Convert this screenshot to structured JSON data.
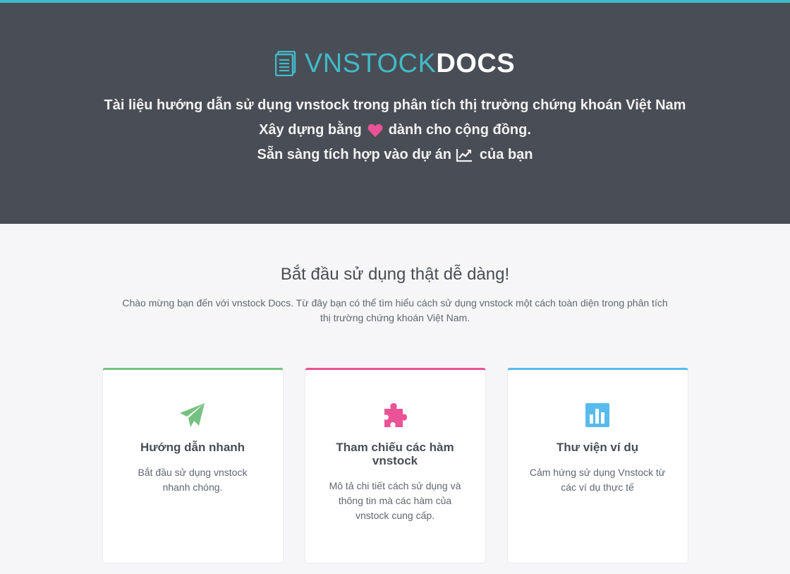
{
  "colors": {
    "accent": "#40bac8",
    "hero_bg": "#494d55",
    "green": "#75c181",
    "pink": "#ea5395",
    "blue": "#58bbee"
  },
  "header": {
    "brand_main": "VNSTOCK",
    "brand_accent": "DOCS",
    "brand_icon": "document-icon",
    "tagline": "Tài liệu hướng dẫn sử dụng vnstock trong phân tích thị trường chứng khoán Việt Nam",
    "line2_before": "Xây dựng bằng",
    "line2_icon": "heart-icon",
    "line2_after": "dành cho cộng đồng.",
    "line3_before": "Sẵn sàng tích hợp vào dự án",
    "line3_icon": "line-chart-icon",
    "line3_after": "của bạn"
  },
  "intro": {
    "title": "Bắt đầu sử dụng thật dễ dàng!",
    "description": "Chào mừng bạn đến với vnstock Docs. Từ đây bạn có thể tìm hiểu cách sử dụng vnstock một cách toàn diện trong phân tích thị trường chứng khoán Việt Nam."
  },
  "cards": [
    {
      "icon": "paper-plane-icon",
      "title": "Hướng dẫn nhanh",
      "description": "Bắt đầu sử dụng vnstock nhanh chóng."
    },
    {
      "icon": "puzzle-piece-icon",
      "title": "Tham chiếu các hàm vnstock",
      "description": "Mô tả chi tiết cách sử dụng và thông tin mà các hàm của vnstock cung cấp."
    },
    {
      "icon": "bar-chart-icon",
      "title": "Thư viện ví dụ",
      "description": "Cảm hứng sử dụng Vnstock từ các ví dụ thực tế"
    }
  ]
}
